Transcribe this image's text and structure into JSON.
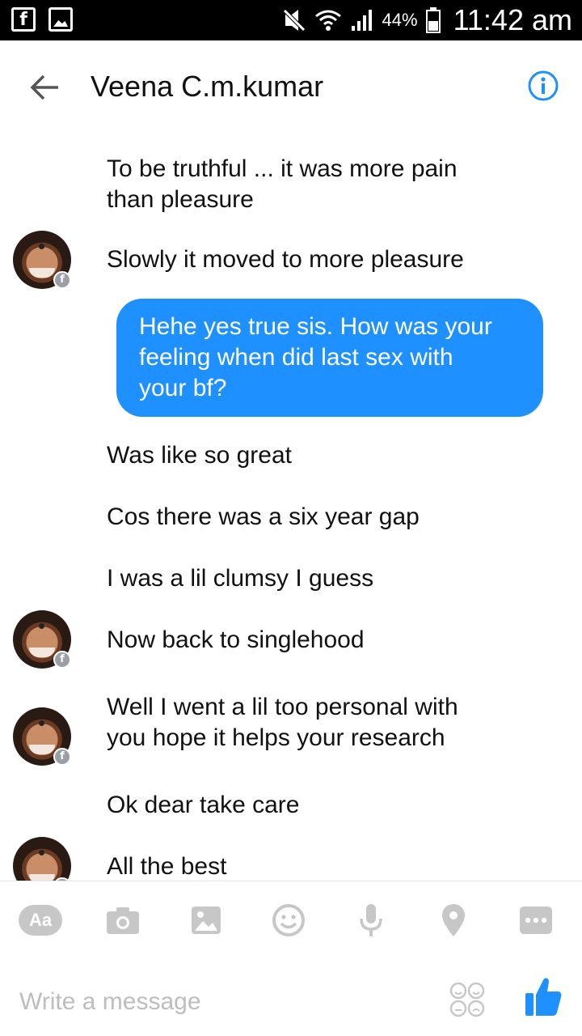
{
  "status_bar": {
    "icons_left": [
      "facebook-icon",
      "gallery-icon"
    ],
    "battery": "44%",
    "time": "11:42 am"
  },
  "header": {
    "title": "Veena C.m.kumar",
    "back_icon": "arrow-left-icon",
    "info_icon": "info-icon",
    "accent": "#1e90ff"
  },
  "messages": [
    {
      "side": "them",
      "text_lines": [
        "To be truthful ... it was more pain",
        "than pleasure"
      ]
    },
    {
      "side": "them",
      "avatar": true,
      "text": "Slowly it moved to more pleasure"
    },
    {
      "side": "me",
      "text_lines": [
        "Hehe yes true sis. How was your",
        "feeling when did last sex with",
        "your bf?"
      ]
    },
    {
      "side": "them",
      "text": "Was like so great"
    },
    {
      "side": "them",
      "text": "Cos there was a six year gap"
    },
    {
      "side": "them",
      "text": "I was a lil clumsy I guess"
    },
    {
      "side": "them",
      "avatar": true,
      "text": "Now back to singlehood"
    },
    {
      "side": "them",
      "avatar": true,
      "text_lines": [
        "Well I went a lil too personal with",
        "you hope it helps your research"
      ]
    },
    {
      "side": "them",
      "text": "Ok dear take care"
    },
    {
      "side": "them",
      "avatar": true,
      "text": "All the best"
    }
  ],
  "composer": {
    "aa_label": "Aa",
    "tools": [
      "camera-icon",
      "image-icon",
      "emoji-icon",
      "microphone-icon",
      "location-icon",
      "more-icon"
    ],
    "placeholder": "Write a message",
    "sticker_icon": "sticker-icon",
    "like_icon": "thumbs-up-icon"
  }
}
